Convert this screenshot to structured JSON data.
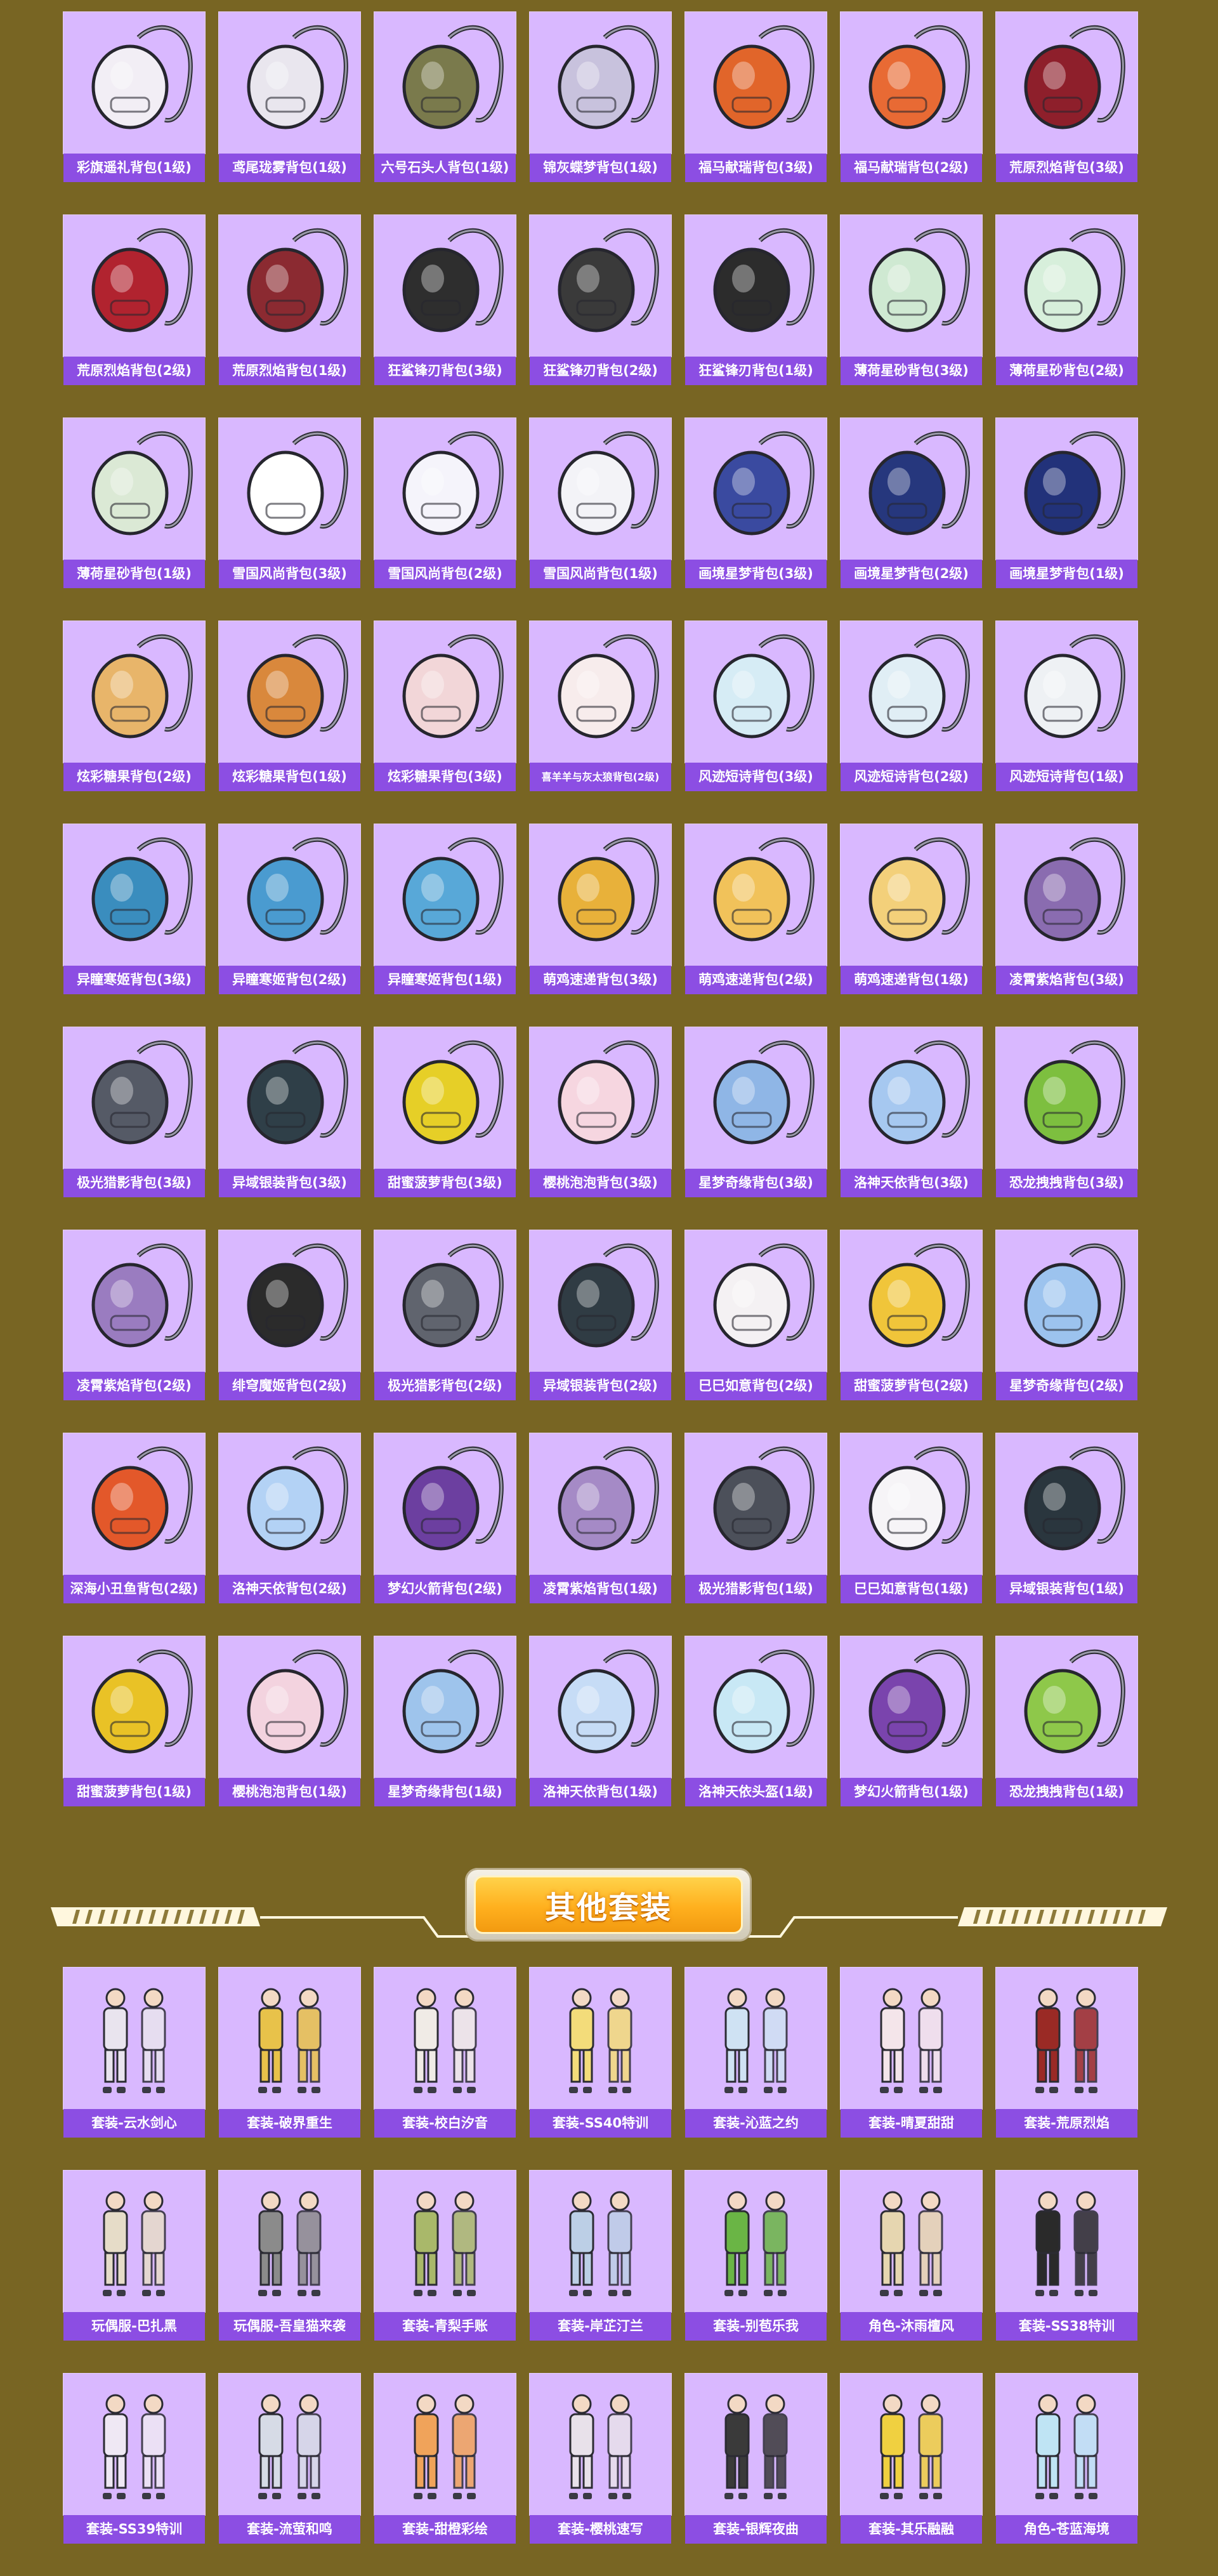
{
  "backpacks": [
    {
      "label": "彩旗遥礼背包(1级)",
      "icon": "bunny-purse-icon",
      "color": "#f2eef5"
    },
    {
      "label": "鸢尾珑雾背包(1级)",
      "icon": "mini-pouch-icon",
      "color": "#e9e6ee"
    },
    {
      "label": "六号石头人背包(1级)",
      "icon": "stone-golem-backpack-icon",
      "color": "#7a7a4c"
    },
    {
      "label": "锦灰蝶梦背包(1级)",
      "icon": "diamond-bag-icon",
      "color": "#c8c2dd"
    },
    {
      "label": "福马献瑞背包(3级)",
      "icon": "rabbit-backpack-icon",
      "color": "#e1652a"
    },
    {
      "label": "福马献瑞背包(2级)",
      "icon": "rabbit-backpack-icon",
      "color": "#e86a34"
    },
    {
      "label": "荒原烈焰背包(3级)",
      "icon": "flame-mask-backpack-icon",
      "color": "#8e1f2b"
    },
    {
      "label": "荒原烈焰背包(2级)",
      "icon": "flame-mask-backpack-icon",
      "color": "#b1232f"
    },
    {
      "label": "荒原烈焰背包(1级)",
      "icon": "flame-mask-backpack-icon",
      "color": "#8b2a31"
    },
    {
      "label": "狂鲨锋刃背包(3级)",
      "icon": "shark-backpack-icon",
      "color": "#2e2e2e"
    },
    {
      "label": "狂鲨锋刃背包(2级)",
      "icon": "shark-backpack-icon",
      "color": "#3a3a3a"
    },
    {
      "label": "狂鲨锋刃背包(1级)",
      "icon": "shark-backpack-icon",
      "color": "#2c2c2c"
    },
    {
      "label": "薄荷星砂背包(3级)",
      "icon": "mint-bag-icon",
      "color": "#cfe9d2"
    },
    {
      "label": "薄荷星砂背包(2级)",
      "icon": "mint-bag-icon",
      "color": "#d7efdb"
    },
    {
      "label": "薄荷星砂背包(1级)",
      "icon": "mint-bag-icon",
      "color": "#dbe9d5"
    },
    {
      "label": "雪国风尚背包(3级)",
      "icon": "snowman-backpack-icon",
      "color": "#ffffff"
    },
    {
      "label": "雪国风尚背包(2级)",
      "icon": "snowman-backpack-icon",
      "color": "#f5f4fb"
    },
    {
      "label": "雪国风尚背包(1级)",
      "icon": "snowman-backpack-icon",
      "color": "#f3f3f7"
    },
    {
      "label": "画境星梦背包(3级)",
      "icon": "storybook-backpack-icon",
      "color": "#3a4aa0"
    },
    {
      "label": "画境星梦背包(2级)",
      "icon": "storybook-backpack-icon",
      "color": "#26377d"
    },
    {
      "label": "画境星梦背包(1级)",
      "icon": "storybook-backpack-icon",
      "color": "#22327a"
    },
    {
      "label": "炫彩糖果背包(2级)",
      "icon": "donut-backpack-icon",
      "color": "#e8b56a"
    },
    {
      "label": "炫彩糖果背包(1级)",
      "icon": "donut-backpack-icon",
      "color": "#d9883c"
    },
    {
      "label": "炫彩糖果背包(3级)",
      "icon": "donut-backpack-icon",
      "color": "#f2d6d8"
    },
    {
      "label": "喜羊羊与灰太狼背包(2级)",
      "icon": "sheep-backpack-icon",
      "color": "#f7ecec",
      "small": true
    },
    {
      "label": "风迹短诗背包(3级)",
      "icon": "poetry-bag-icon",
      "color": "#d6ecf5"
    },
    {
      "label": "风迹短诗背包(2级)",
      "icon": "poetry-bag-icon",
      "color": "#e0eef5"
    },
    {
      "label": "风迹短诗背包(1级)",
      "icon": "poetry-bag-icon",
      "color": "#eef1f4"
    },
    {
      "label": "异瞳寒姬背包(3级)",
      "icon": "ice-cat-backpack-icon",
      "color": "#3a8dbe"
    },
    {
      "label": "异瞳寒姬背包(2级)",
      "icon": "ice-cat-backpack-icon",
      "color": "#4a9bd0"
    },
    {
      "label": "异瞳寒姬背包(1级)",
      "icon": "ice-cat-backpack-icon",
      "color": "#58a8d8"
    },
    {
      "label": "萌鸡速递背包(3级)",
      "icon": "chick-backpack-icon",
      "color": "#e8b13a"
    },
    {
      "label": "萌鸡速递背包(2级)",
      "icon": "chick-backpack-icon",
      "color": "#f1c25a"
    },
    {
      "label": "萌鸡速递背包(1级)",
      "icon": "chick-backpack-icon",
      "color": "#f3d07a"
    },
    {
      "label": "凌霄紫焰背包(3级)",
      "icon": "purple-flame-pendant-icon",
      "color": "#8a6cb0"
    },
    {
      "label": "极光猎影背包(3级)",
      "icon": "aurora-hunter-backpack-icon",
      "color": "#555a66"
    },
    {
      "label": "异域银装背包(3级)",
      "icon": "tech-backpack-icon",
      "color": "#2f3f48"
    },
    {
      "label": "甜蜜菠萝背包(3级)",
      "icon": "pineapple-backpack-icon",
      "color": "#e6cf27"
    },
    {
      "label": "樱桃泡泡背包(3级)",
      "icon": "bow-bag-icon",
      "color": "#f6d6e0"
    },
    {
      "label": "星梦奇缘背包(3级)",
      "icon": "swan-backpack-icon",
      "color": "#8fb6e6"
    },
    {
      "label": "洛神天依背包(3级)",
      "icon": "idol-backpack-icon",
      "color": "#a6c8f0"
    },
    {
      "label": "恐龙拽拽背包(3级)",
      "icon": "dino-backpack-icon",
      "color": "#7dbf3f"
    },
    {
      "label": "凌霄紫焰背包(2级)",
      "icon": "purple-flame-pendant-icon",
      "color": "#9a7cc0"
    },
    {
      "label": "绯穹魔姬背包(2级)",
      "icon": "demon-backpack-icon",
      "color": "#2b2b2b"
    },
    {
      "label": "极光猎影背包(2级)",
      "icon": "aurora-hunter-backpack-icon",
      "color": "#60646e"
    },
    {
      "label": "异域银装背包(2级)",
      "icon": "tech-backpack-icon",
      "color": "#303c44"
    },
    {
      "label": "巳巳如意背包(2级)",
      "icon": "snake-backpack-icon",
      "color": "#f4f1f3"
    },
    {
      "label": "甜蜜菠萝背包(2级)",
      "icon": "pineapple-backpack-icon",
      "color": "#f0c53a"
    },
    {
      "label": "星梦奇缘背包(2级)",
      "icon": "swan-backpack-icon",
      "color": "#9cc3ee"
    },
    {
      "label": "深海小丑鱼背包(2级)",
      "icon": "clownfish-backpack-icon",
      "color": "#e3582a"
    },
    {
      "label": "洛神天依背包(2级)",
      "icon": "idol-backpack-icon",
      "color": "#b3d2f5"
    },
    {
      "label": "梦幻火箭背包(2级)",
      "icon": "rocket-backpack-icon",
      "color": "#6c3fa0"
    },
    {
      "label": "凌霄紫焰背包(1级)",
      "icon": "purple-flame-pendant-icon",
      "color": "#a58ac6"
    },
    {
      "label": "极光猎影背包(1级)",
      "icon": "aurora-hunter-backpack-icon",
      "color": "#4c505a"
    },
    {
      "label": "巳巳如意背包(1级)",
      "icon": "snake-backpack-icon",
      "color": "#f6f4f7"
    },
    {
      "label": "异域银装背包(1级)",
      "icon": "tech-backpack-icon",
      "color": "#2a363e"
    },
    {
      "label": "甜蜜菠萝背包(1级)",
      "icon": "pineapple-backpack-icon",
      "color": "#e9c226"
    },
    {
      "label": "樱桃泡泡背包(1级)",
      "icon": "bow-bag-icon",
      "color": "#f3d3df"
    },
    {
      "label": "星梦奇缘背包(1级)",
      "icon": "swan-backpack-icon",
      "color": "#9ec4ec"
    },
    {
      "label": "洛神天依背包(1级)",
      "icon": "idol-backpack-icon",
      "color": "#c6dcf6"
    },
    {
      "label": "洛神天依头盔(1级)",
      "icon": "helmet-icon",
      "color": "#c8e8f5"
    },
    {
      "label": "梦幻火箭背包(1级)",
      "icon": "rocket-backpack-icon",
      "color": "#7a44ad"
    },
    {
      "label": "恐龙拽拽背包(1级)",
      "icon": "dino-backpack-icon",
      "color": "#8ec84a"
    }
  ],
  "section": {
    "title": "其他套装"
  },
  "outfits": [
    {
      "label": "套装-云水剑心",
      "icon": "outfit-pair-icon",
      "color": "#e9e4ee"
    },
    {
      "label": "套装-破界重生",
      "icon": "outfit-pair-icon",
      "color": "#e8c24a"
    },
    {
      "label": "套装-校白汐音",
      "icon": "outfit-pair-icon",
      "color": "#f0ebe6"
    },
    {
      "label": "套装-SS40特训",
      "icon": "outfit-set-icon",
      "color": "#f3dc7a"
    },
    {
      "label": "套装-沁蓝之约",
      "icon": "outfit-pair-icon",
      "color": "#cfe2f3"
    },
    {
      "label": "套装-晴夏甜甜",
      "icon": "outfit-pair-icon",
      "color": "#f4e5ea"
    },
    {
      "label": "套装-荒原烈焰",
      "icon": "outfit-pair-icon",
      "color": "#9a2a25"
    },
    {
      "label": "玩偶服-巴扎黑",
      "icon": "mascot-suit-icon",
      "color": "#e6dcc8"
    },
    {
      "label": "玩偶服-吾皇猫来袭",
      "icon": "mascot-suit-icon",
      "color": "#8b8b8b"
    },
    {
      "label": "套装-青梨手账",
      "icon": "outfit-set-icon",
      "color": "#a9b86a"
    },
    {
      "label": "套装-岸芷汀兰",
      "icon": "outfit-pair-icon",
      "color": "#bccfe6"
    },
    {
      "label": "套装-别苞乐我",
      "icon": "mascot-suit-icon",
      "color": "#6ab545"
    },
    {
      "label": "角色-沐雨檀风",
      "icon": "character-icon",
      "color": "#e6d6b0"
    },
    {
      "label": "套装-SS38特训",
      "icon": "outfit-set-icon",
      "color": "#2a2a2a"
    },
    {
      "label": "套装-SS39特训",
      "icon": "outfit-set-icon",
      "color": "#efe8f4"
    },
    {
      "label": "套装-流萤和鸣",
      "icon": "outfit-pair-icon",
      "color": "#d6dbe6"
    },
    {
      "label": "套装-甜橙彩绘",
      "icon": "outfit-pair-icon",
      "color": "#f0a35a"
    },
    {
      "label": "套装-樱桃速写",
      "icon": "outfit-pair-icon",
      "color": "#e8e1ea"
    },
    {
      "label": "套装-银辉夜曲",
      "icon": "outfit-pair-icon",
      "color": "#3a3a3a"
    },
    {
      "label": "套装-其乐融融",
      "icon": "outfit-pair-icon",
      "color": "#f0d040"
    },
    {
      "label": "角色-苍蓝海境",
      "icon": "character-icon",
      "color": "#bfe4f4"
    }
  ]
}
